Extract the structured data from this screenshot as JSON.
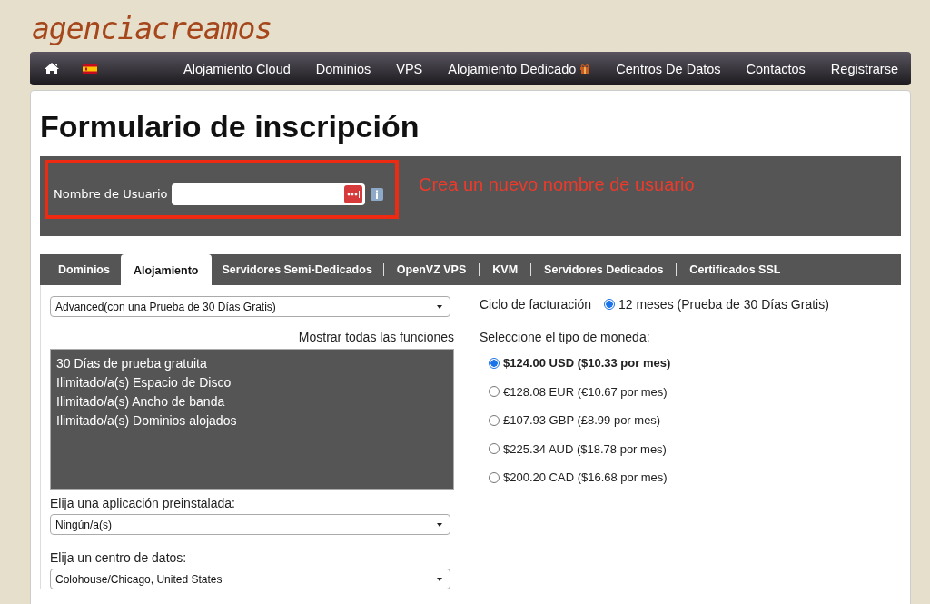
{
  "logo": "agenciacreamos",
  "nav": {
    "items": [
      {
        "label": "Alojamiento Cloud",
        "gift": false
      },
      {
        "label": "Dominios",
        "gift": false
      },
      {
        "label": "VPS",
        "gift": false
      },
      {
        "label": "Alojamiento Dedicado",
        "gift": true
      },
      {
        "label": "Centros De Datos",
        "gift": false
      },
      {
        "label": "Contactos",
        "gift": false
      },
      {
        "label": "Registrarse",
        "gift": false
      }
    ]
  },
  "title": "Formulario de inscripción",
  "username": {
    "label": "Nombre de Usuario",
    "hint": "Crea un nuevo nombre de usuario"
  },
  "tabs": [
    {
      "label": "Dominios",
      "selected": false
    },
    {
      "label": "Alojamiento",
      "selected": true
    },
    {
      "label": "Servidores Semi-Dedicados",
      "selected": false
    },
    {
      "label": "OpenVZ VPS",
      "selected": false
    },
    {
      "label": "KVM",
      "selected": false
    },
    {
      "label": "Servidores Dedicados",
      "selected": false
    },
    {
      "label": "Certificados SSL",
      "selected": false
    }
  ],
  "plan": {
    "value": "Advanced(con una Prueba de 30 Días Gratis)"
  },
  "show_all": "Mostrar todas las funciones",
  "features": [
    "30 Días de prueba gratuita",
    "Ilimitado/a(s) Espacio de Disco",
    "Ilimitado/a(s) Ancho de banda",
    "Ilimitado/a(s) Dominios alojados"
  ],
  "app": {
    "label": "Elija una aplicación preinstalada:",
    "value": "Ningún/a(s)"
  },
  "datacenter": {
    "label": "Elija un centro de datos:",
    "value": "Colohouse/Chicago, United States"
  },
  "billing": {
    "label": "Ciclo de facturación",
    "options": [
      {
        "label": "12 meses (Prueba de 30 Días Gratis)",
        "selected": true
      }
    ]
  },
  "currency": {
    "label": "Seleccione el tipo de moneda:",
    "options": [
      {
        "label": "$124.00 USD ($10.33 por mes)",
        "selected": true
      },
      {
        "label": "€128.08 EUR (€10.67 por mes)",
        "selected": false
      },
      {
        "label": "£107.93 GBP (£8.99 por mes)",
        "selected": false
      },
      {
        "label": "$225.34 AUD ($18.78 por mes)",
        "selected": false
      },
      {
        "label": "$200.20 CAD ($16.68 por mes)",
        "selected": false
      }
    ]
  }
}
